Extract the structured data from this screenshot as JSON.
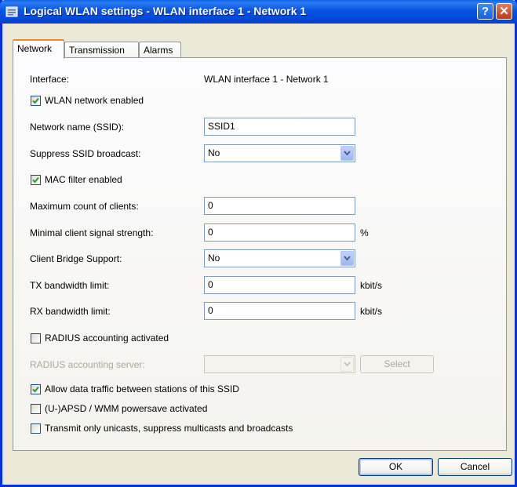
{
  "window": {
    "title": "Logical WLAN settings - WLAN interface 1 - Network 1"
  },
  "tabs": [
    {
      "label": "Network"
    },
    {
      "label": "Transmission"
    },
    {
      "label": "Alarms"
    }
  ],
  "form": {
    "interface_label": "Interface:",
    "interface_value": "WLAN interface 1 - Network 1",
    "wlan_enabled": {
      "label": "WLAN network enabled",
      "checked": true
    },
    "ssid": {
      "label": "Network name (SSID):",
      "value": "SSID1"
    },
    "suppress": {
      "label": "Suppress SSID broadcast:",
      "value": "No"
    },
    "mac_filter": {
      "label": "MAC filter enabled",
      "checked": true
    },
    "max_clients": {
      "label": "Maximum count of clients:",
      "value": "0"
    },
    "signal": {
      "label": "Minimal client signal strength:",
      "value": "0",
      "unit": "%"
    },
    "bridge": {
      "label": "Client Bridge Support:",
      "value": "No"
    },
    "tx": {
      "label": "TX bandwidth limit:",
      "value": "0",
      "unit": "kbit/s"
    },
    "rx": {
      "label": "RX bandwidth limit:",
      "value": "0",
      "unit": "kbit/s"
    },
    "radius_acct": {
      "label": "RADIUS accounting activated",
      "checked": false
    },
    "radius_server": {
      "label": "RADIUS accounting server:",
      "value": "",
      "select_label": "Select"
    },
    "allow_traffic": {
      "label": "Allow data traffic between stations of this SSID",
      "checked": true
    },
    "apsd": {
      "label": "(U-)APSD / WMM powersave activated",
      "checked": false
    },
    "unicast_only": {
      "label": "Transmit only unicasts, suppress multicasts and broadcasts",
      "checked": false
    }
  },
  "buttons": {
    "ok": "OK",
    "cancel": "Cancel"
  },
  "colors": {
    "titlebar": "#0554E3",
    "accent_tab": "#E68B2C",
    "checkmark": "#21A121"
  }
}
